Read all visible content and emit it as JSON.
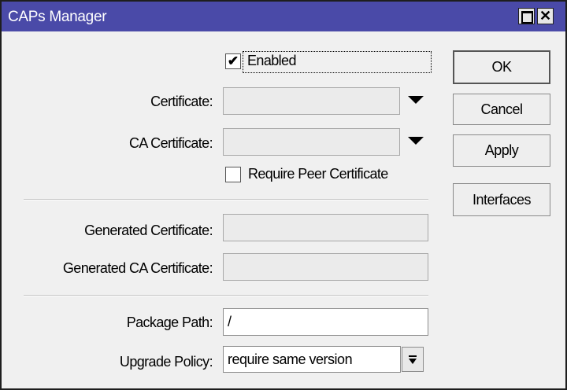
{
  "window": {
    "title": "CAPs Manager",
    "close_glyph": "✕"
  },
  "enabled": {
    "label": "Enabled",
    "checked": true,
    "check_glyph": "✔"
  },
  "certificate": {
    "label": "Certificate:",
    "value": ""
  },
  "ca_certificate": {
    "label": "CA Certificate:",
    "value": ""
  },
  "require_peer_certificate": {
    "label": "Require Peer Certificate",
    "checked": false
  },
  "generated_certificate": {
    "label": "Generated Certificate:",
    "value": ""
  },
  "generated_ca_certificate": {
    "label": "Generated CA Certificate:",
    "value": ""
  },
  "package_path": {
    "label": "Package Path:",
    "value": "/"
  },
  "upgrade_policy": {
    "label": "Upgrade Policy:",
    "value": "require same version"
  },
  "buttons": {
    "ok": "OK",
    "cancel": "Cancel",
    "apply": "Apply",
    "interfaces": "Interfaces"
  },
  "icons": {
    "maximize": "maximize-icon",
    "close": "close-icon",
    "dropdown": "dropdown-arrow-icon",
    "select_toggle": "select-arrow-icon"
  }
}
